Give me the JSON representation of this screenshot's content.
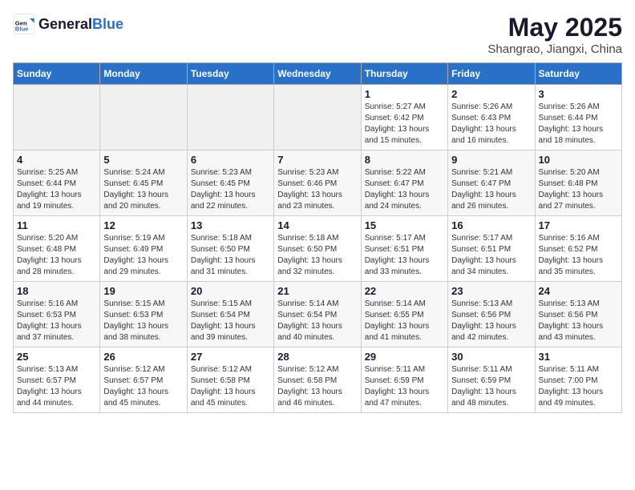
{
  "header": {
    "logo_general": "General",
    "logo_blue": "Blue",
    "title": "May 2025",
    "subtitle": "Shangrao, Jiangxi, China"
  },
  "weekdays": [
    "Sunday",
    "Monday",
    "Tuesday",
    "Wednesday",
    "Thursday",
    "Friday",
    "Saturday"
  ],
  "weeks": [
    [
      {
        "num": "",
        "info": "",
        "empty": true
      },
      {
        "num": "",
        "info": "",
        "empty": true
      },
      {
        "num": "",
        "info": "",
        "empty": true
      },
      {
        "num": "",
        "info": "",
        "empty": true
      },
      {
        "num": "1",
        "info": "Sunrise: 5:27 AM\nSunset: 6:42 PM\nDaylight: 13 hours\nand 15 minutes.",
        "empty": false
      },
      {
        "num": "2",
        "info": "Sunrise: 5:26 AM\nSunset: 6:43 PM\nDaylight: 13 hours\nand 16 minutes.",
        "empty": false
      },
      {
        "num": "3",
        "info": "Sunrise: 5:26 AM\nSunset: 6:44 PM\nDaylight: 13 hours\nand 18 minutes.",
        "empty": false
      }
    ],
    [
      {
        "num": "4",
        "info": "Sunrise: 5:25 AM\nSunset: 6:44 PM\nDaylight: 13 hours\nand 19 minutes.",
        "empty": false
      },
      {
        "num": "5",
        "info": "Sunrise: 5:24 AM\nSunset: 6:45 PM\nDaylight: 13 hours\nand 20 minutes.",
        "empty": false
      },
      {
        "num": "6",
        "info": "Sunrise: 5:23 AM\nSunset: 6:45 PM\nDaylight: 13 hours\nand 22 minutes.",
        "empty": false
      },
      {
        "num": "7",
        "info": "Sunrise: 5:23 AM\nSunset: 6:46 PM\nDaylight: 13 hours\nand 23 minutes.",
        "empty": false
      },
      {
        "num": "8",
        "info": "Sunrise: 5:22 AM\nSunset: 6:47 PM\nDaylight: 13 hours\nand 24 minutes.",
        "empty": false
      },
      {
        "num": "9",
        "info": "Sunrise: 5:21 AM\nSunset: 6:47 PM\nDaylight: 13 hours\nand 26 minutes.",
        "empty": false
      },
      {
        "num": "10",
        "info": "Sunrise: 5:20 AM\nSunset: 6:48 PM\nDaylight: 13 hours\nand 27 minutes.",
        "empty": false
      }
    ],
    [
      {
        "num": "11",
        "info": "Sunrise: 5:20 AM\nSunset: 6:48 PM\nDaylight: 13 hours\nand 28 minutes.",
        "empty": false
      },
      {
        "num": "12",
        "info": "Sunrise: 5:19 AM\nSunset: 6:49 PM\nDaylight: 13 hours\nand 29 minutes.",
        "empty": false
      },
      {
        "num": "13",
        "info": "Sunrise: 5:18 AM\nSunset: 6:50 PM\nDaylight: 13 hours\nand 31 minutes.",
        "empty": false
      },
      {
        "num": "14",
        "info": "Sunrise: 5:18 AM\nSunset: 6:50 PM\nDaylight: 13 hours\nand 32 minutes.",
        "empty": false
      },
      {
        "num": "15",
        "info": "Sunrise: 5:17 AM\nSunset: 6:51 PM\nDaylight: 13 hours\nand 33 minutes.",
        "empty": false
      },
      {
        "num": "16",
        "info": "Sunrise: 5:17 AM\nSunset: 6:51 PM\nDaylight: 13 hours\nand 34 minutes.",
        "empty": false
      },
      {
        "num": "17",
        "info": "Sunrise: 5:16 AM\nSunset: 6:52 PM\nDaylight: 13 hours\nand 35 minutes.",
        "empty": false
      }
    ],
    [
      {
        "num": "18",
        "info": "Sunrise: 5:16 AM\nSunset: 6:53 PM\nDaylight: 13 hours\nand 37 minutes.",
        "empty": false
      },
      {
        "num": "19",
        "info": "Sunrise: 5:15 AM\nSunset: 6:53 PM\nDaylight: 13 hours\nand 38 minutes.",
        "empty": false
      },
      {
        "num": "20",
        "info": "Sunrise: 5:15 AM\nSunset: 6:54 PM\nDaylight: 13 hours\nand 39 minutes.",
        "empty": false
      },
      {
        "num": "21",
        "info": "Sunrise: 5:14 AM\nSunset: 6:54 PM\nDaylight: 13 hours\nand 40 minutes.",
        "empty": false
      },
      {
        "num": "22",
        "info": "Sunrise: 5:14 AM\nSunset: 6:55 PM\nDaylight: 13 hours\nand 41 minutes.",
        "empty": false
      },
      {
        "num": "23",
        "info": "Sunrise: 5:13 AM\nSunset: 6:56 PM\nDaylight: 13 hours\nand 42 minutes.",
        "empty": false
      },
      {
        "num": "24",
        "info": "Sunrise: 5:13 AM\nSunset: 6:56 PM\nDaylight: 13 hours\nand 43 minutes.",
        "empty": false
      }
    ],
    [
      {
        "num": "25",
        "info": "Sunrise: 5:13 AM\nSunset: 6:57 PM\nDaylight: 13 hours\nand 44 minutes.",
        "empty": false
      },
      {
        "num": "26",
        "info": "Sunrise: 5:12 AM\nSunset: 6:57 PM\nDaylight: 13 hours\nand 45 minutes.",
        "empty": false
      },
      {
        "num": "27",
        "info": "Sunrise: 5:12 AM\nSunset: 6:58 PM\nDaylight: 13 hours\nand 45 minutes.",
        "empty": false
      },
      {
        "num": "28",
        "info": "Sunrise: 5:12 AM\nSunset: 6:58 PM\nDaylight: 13 hours\nand 46 minutes.",
        "empty": false
      },
      {
        "num": "29",
        "info": "Sunrise: 5:11 AM\nSunset: 6:59 PM\nDaylight: 13 hours\nand 47 minutes.",
        "empty": false
      },
      {
        "num": "30",
        "info": "Sunrise: 5:11 AM\nSunset: 6:59 PM\nDaylight: 13 hours\nand 48 minutes.",
        "empty": false
      },
      {
        "num": "31",
        "info": "Sunrise: 5:11 AM\nSunset: 7:00 PM\nDaylight: 13 hours\nand 49 minutes.",
        "empty": false
      }
    ]
  ]
}
